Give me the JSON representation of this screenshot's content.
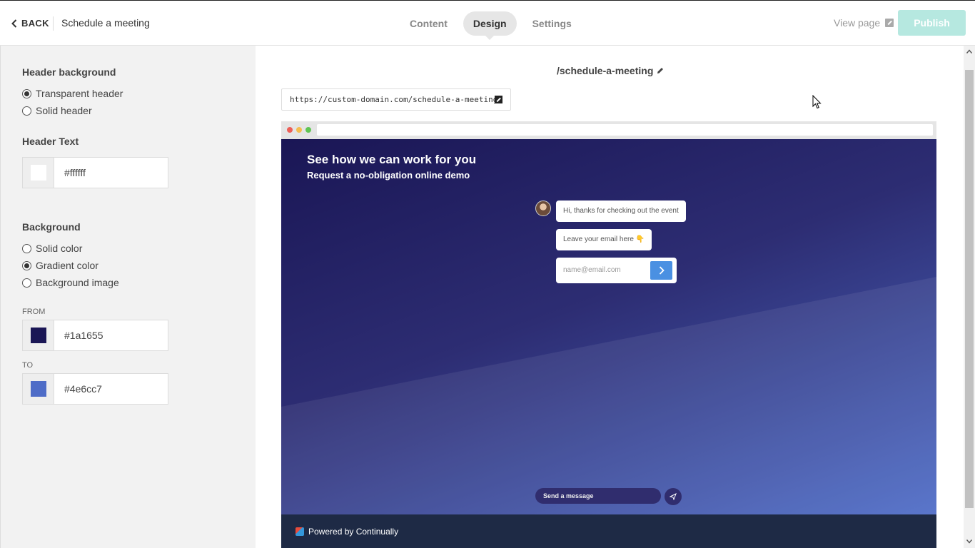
{
  "topbar": {
    "back_label": "BACK",
    "page_name": "Schedule a meeting",
    "tabs": [
      {
        "label": "Content",
        "active": false
      },
      {
        "label": "Design",
        "active": true
      },
      {
        "label": "Settings",
        "active": false
      }
    ],
    "view_page_label": "View page",
    "publish_label": "Publish"
  },
  "sidebar": {
    "header_background_title": "Header background",
    "header_background_options": [
      {
        "label": "Transparent header",
        "selected": true
      },
      {
        "label": "Solid header",
        "selected": false
      }
    ],
    "header_text_title": "Header Text",
    "header_text_color": "#ffffff",
    "background_title": "Background",
    "background_options": [
      {
        "label": "Solid color",
        "selected": false
      },
      {
        "label": "Gradient color",
        "selected": true
      },
      {
        "label": "Background image",
        "selected": false
      }
    ],
    "from_label": "FROM",
    "from_color": "#1a1655",
    "to_label": "TO",
    "to_color": "#4e6cc7"
  },
  "main": {
    "slug": "/schedule-a-meeting",
    "url": "https://custom-domain.com/schedule-a-meeting/"
  },
  "preview": {
    "hero_title": "See how we can work for you",
    "hero_subtitle": "Request a no-obligation online demo",
    "bubbles": [
      "Hi, thanks for checking out the event",
      "Leave your email here 👇"
    ],
    "email_placeholder": "name@email.com",
    "message_placeholder": "Send a message",
    "footer_text": "Powered by Continually"
  },
  "colors": {
    "publish_bg": "#b6e8e0",
    "gradient_from": "#1a1655",
    "gradient_to": "#4e6cc7",
    "footer_bg": "#1e2a45",
    "send_button": "#4a90e2"
  }
}
